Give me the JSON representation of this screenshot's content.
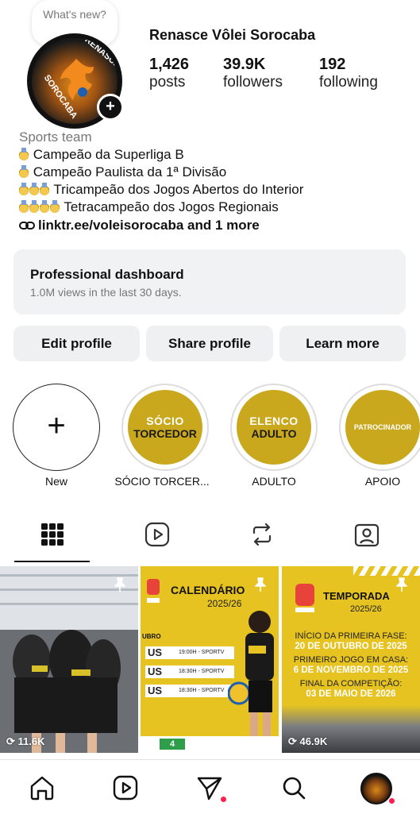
{
  "note_bubble": {
    "text": "What's new?"
  },
  "profile": {
    "name": "Renasce Vôlei Sorocaba",
    "avatar_text_top": "RENASCE",
    "avatar_text_left": "SOROCABA",
    "stats": [
      {
        "value": "1,426",
        "label": "posts"
      },
      {
        "value": "39.9K",
        "label": "followers"
      },
      {
        "value": "192",
        "label": "following"
      }
    ]
  },
  "bio": {
    "category": "Sports team",
    "lines": [
      {
        "medals": 1,
        "text": "Campeão da Superliga B"
      },
      {
        "medals": 1,
        "text": "Campeão Paulista da 1ª Divisão"
      },
      {
        "medals": 3,
        "text": "Tricampeão dos Jogos Abertos do Interior"
      },
      {
        "medals": 4,
        "text": "Tetracampeão dos Jogos Regionais"
      }
    ],
    "link": "linktr.ee/voleisorocaba and 1 more"
  },
  "dashboard": {
    "title": "Professional dashboard",
    "subtitle": "1.0M views in the last 30 days."
  },
  "buttons": {
    "edit": "Edit profile",
    "share": "Share profile",
    "learn": "Learn more"
  },
  "highlights": {
    "new_label": "New",
    "items": [
      {
        "line1": "SÓCIO",
        "line2": "TORCEDOR",
        "label": "SÓCIO TORCER..."
      },
      {
        "line1": "ELENCO",
        "line2": "ADULTO",
        "label": "ADULTO"
      },
      {
        "line1": "PATROCINADOR",
        "line2": "",
        "label": "APOIO"
      }
    ]
  },
  "tabs": [
    "grid-icon",
    "reels-icon",
    "reposts-icon",
    "tagged-icon"
  ],
  "posts": [
    {
      "views": "11.6K"
    },
    {
      "title": "CALENDÁRIO",
      "season": "2025/26",
      "label_left": "UBRO",
      "rows": [
        {
          "team": "US",
          "time": "19:00H - SPORTV"
        },
        {
          "team": "US",
          "time": "18:30H - SPORTV"
        },
        {
          "team": "US",
          "time": "18:30H - SPORTV"
        }
      ],
      "footer_badge": "4"
    },
    {
      "title": "TEMPORADA",
      "season": "2025/26",
      "line1": "INÍCIO DA PRIMEIRA FASE:",
      "date1": "20 DE OUTUBRO DE 2025",
      "line2": "PRIMEIRO JOGO EM CASA:",
      "date2": "6 DE NOVEMBRO DE 2025",
      "line3": "FINAL DA COMPETIÇÃO:",
      "date3": "03 DE MAIO DE 2026",
      "views": "46.9K"
    }
  ],
  "bottom_nav": [
    "home-icon",
    "reels-icon",
    "messages-icon",
    "search-icon",
    "profile-avatar"
  ],
  "colors": {
    "accent_yellow": "#c9a81d",
    "notification_red": "#ff1f4f"
  }
}
